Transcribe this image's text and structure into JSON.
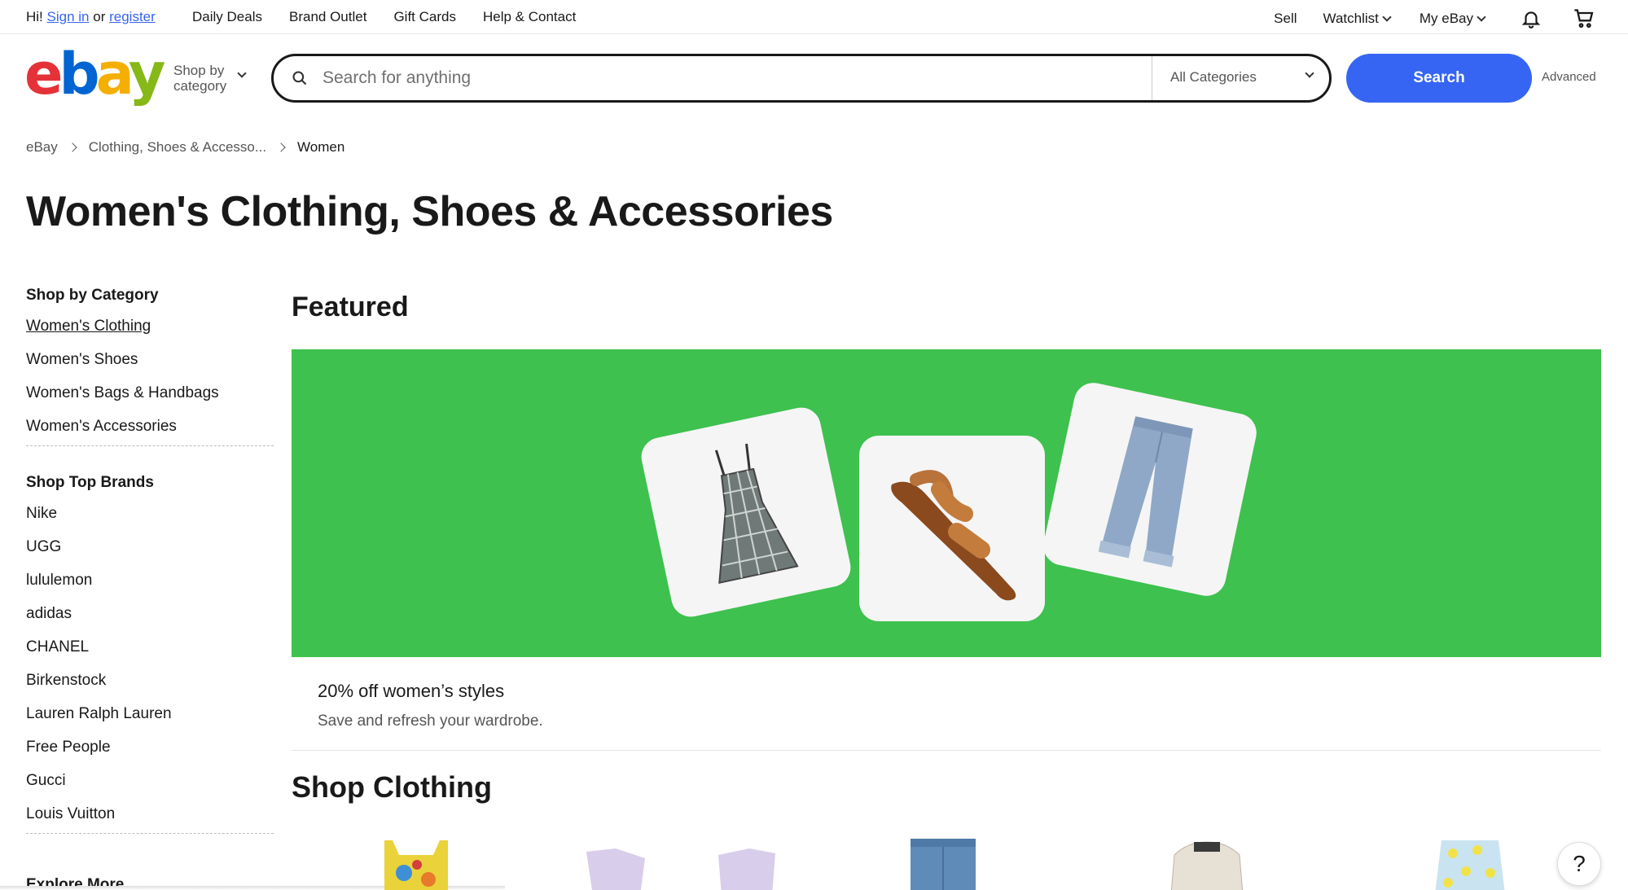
{
  "topbar": {
    "greeting": "Hi!",
    "sign_in": "Sign in",
    "or": "or",
    "register": "register",
    "links": [
      "Daily Deals",
      "Brand Outlet",
      "Gift Cards",
      "Help & Contact"
    ],
    "sell": "Sell",
    "watchlist": "Watchlist",
    "my_ebay": "My eBay"
  },
  "header": {
    "logo": "ebay",
    "shop_by_line1": "Shop by",
    "shop_by_line2": "category",
    "search_placeholder": "Search for anything",
    "category_select": "All Categories",
    "search_button": "Search",
    "advanced": "Advanced"
  },
  "breadcrumb": [
    "eBay",
    "Clothing, Shoes & Accesso...",
    "Women"
  ],
  "page_title": "Women's Clothing, Shoes & Accessories",
  "sidebar": {
    "category_heading": "Shop by Category",
    "categories": [
      "Women's Clothing",
      "Women's Shoes",
      "Women's Bags & Handbags",
      "Women's Accessories"
    ],
    "brands_heading": "Shop Top Brands",
    "brands": [
      "Nike",
      "UGG",
      "lululemon",
      "adidas",
      "CHANEL",
      "Birkenstock",
      "Lauren Ralph Lauren",
      "Free People",
      "Gucci",
      "Louis Vuitton"
    ],
    "explore_heading": "Explore More"
  },
  "featured": {
    "heading": "Featured",
    "banner_color": "#3ec14e",
    "promo_title": "20% off women’s styles",
    "promo_subtitle": "Save and refresh your wardrobe."
  },
  "shop_clothing": {
    "heading": "Shop Clothing"
  },
  "help": "?",
  "colors": {
    "accent": "#3665f3",
    "banner": "#3ec14e"
  }
}
